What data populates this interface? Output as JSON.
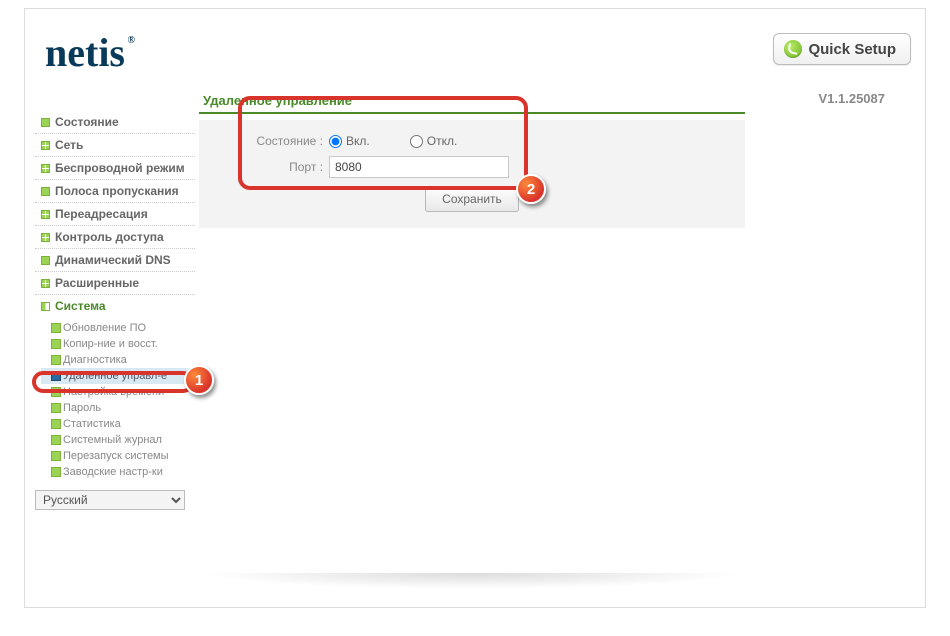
{
  "header": {
    "logo": "netis",
    "quick_setup": "Quick Setup"
  },
  "version": "V1.1.25087",
  "sidebar": {
    "items": [
      {
        "label": "Состояние"
      },
      {
        "label": "Сеть"
      },
      {
        "label": "Беспроводной режим"
      },
      {
        "label": "Полоса пропускания"
      },
      {
        "label": "Переадресация"
      },
      {
        "label": "Контроль доступа"
      },
      {
        "label": "Динамический DNS"
      },
      {
        "label": "Расширенные"
      },
      {
        "label": "Система"
      }
    ],
    "system_children": [
      {
        "label": "Обновление ПО"
      },
      {
        "label": "Копир-ние и восст."
      },
      {
        "label": "Диагностика"
      },
      {
        "label": "Удаленное управл-е"
      },
      {
        "label": "Настройка времени"
      },
      {
        "label": "Пароль"
      },
      {
        "label": "Статистика"
      },
      {
        "label": "Системный журнал"
      },
      {
        "label": "Перезапуск системы"
      },
      {
        "label": "Заводские настр-ки"
      }
    ],
    "language": "Русский"
  },
  "panel": {
    "title": "Удаленное управление",
    "state_label": "Состояние :",
    "state_on": "Вкл.",
    "state_off": "Откл.",
    "state_value": "on",
    "port_label": "Порт :",
    "port_value": "8080",
    "save": "Сохранить"
  },
  "annotations": {
    "m1": "1",
    "m2": "2"
  }
}
